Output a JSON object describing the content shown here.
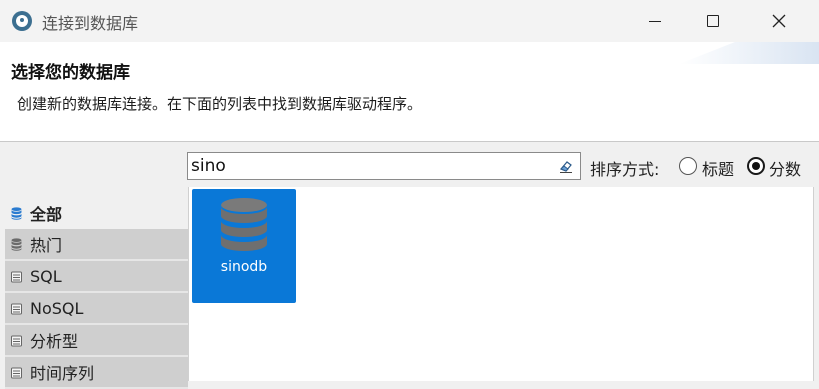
{
  "window": {
    "title": "连接到数据库"
  },
  "header": {
    "title": "选择您的数据库",
    "description": "创建新的数据库连接。在下面的列表中找到数据库驱动程序。"
  },
  "search": {
    "value": "sino"
  },
  "sort": {
    "label": "排序方式:",
    "options": [
      "标题",
      "分数"
    ],
    "selected": "分数"
  },
  "categories": [
    {
      "label": "全部",
      "icon": "database-stack-icon",
      "active": true
    },
    {
      "label": "热门",
      "icon": "database-stack-icon",
      "active": false
    },
    {
      "label": "SQL",
      "icon": "database-icon",
      "active": false
    },
    {
      "label": "NoSQL",
      "icon": "database-icon",
      "active": false
    },
    {
      "label": "分析型",
      "icon": "database-icon",
      "active": false
    },
    {
      "label": "时间序列",
      "icon": "database-icon",
      "active": false
    }
  ],
  "results": [
    {
      "label": "sinodb",
      "icon": "database-cylinder-icon",
      "selected": true
    }
  ],
  "colors": {
    "accent": "#0a78d7",
    "category_bg": "#cfcfcf"
  }
}
